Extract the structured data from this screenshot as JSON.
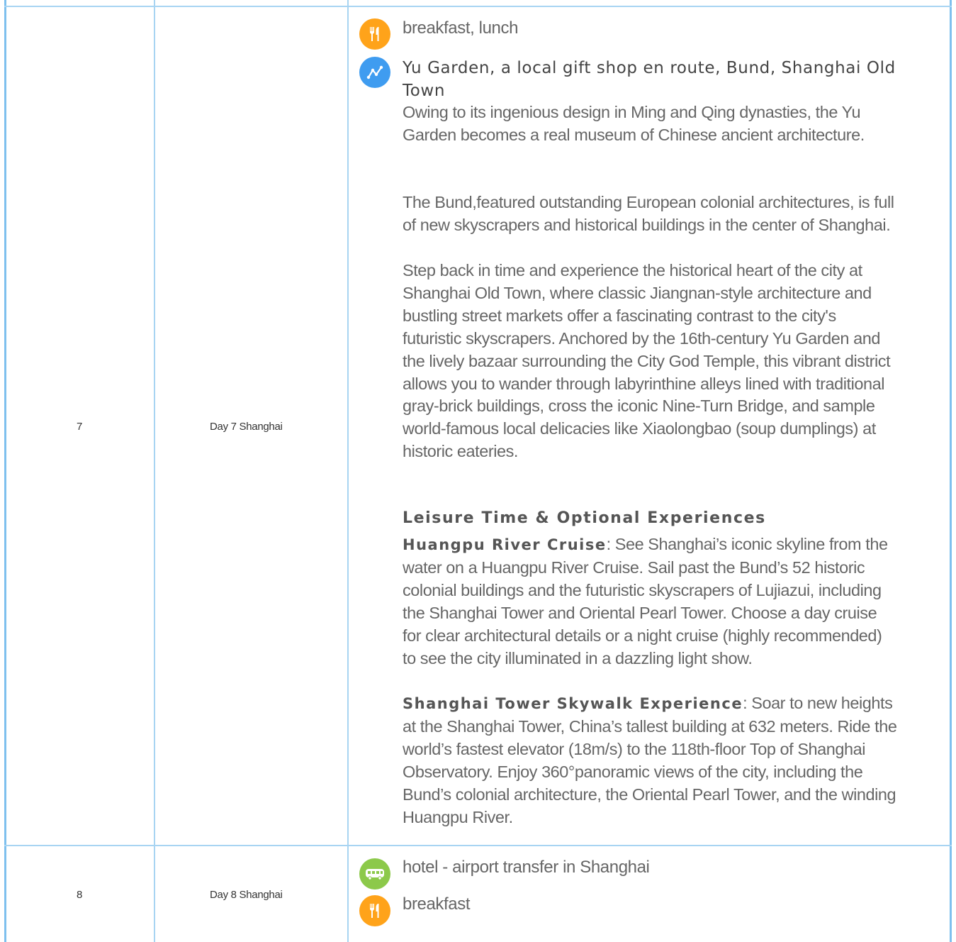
{
  "rows": [
    {
      "day_number": "7",
      "day_label": "Day 7 Shanghai",
      "meals": "breakfast, lunch",
      "route_title": "Yu Garden, a local gift shop en route, Bund, Shanghai Old Town",
      "paragraphs": [
        "Owing to its ingenious design in Ming and Qing dynasties, the Yu Garden becomes a real museum of Chinese ancient architecture.",
        "The Bund,featured outstanding European colonial architectures, is full of new skyscrapers and historical buildings in the center of Shanghai.",
        "Step back in time and experience the historical heart of the city at Shanghai Old Town, where classic Jiangnan-style architecture and bustling street markets offer a fascinating contrast to the city's futuristic skyscrapers. Anchored by the 16th-century Yu Garden and the lively bazaar surrounding the City God Temple, this vibrant district allows you to wander through labyrinthine alleys lined with traditional gray-brick buildings, cross the iconic Nine-Turn Bridge, and sample world-famous local delicacies like Xiaolongbao (soup dumplings) at historic eateries."
      ],
      "optional_heading": "Leisure Time & Optional Experiences",
      "optional": [
        {
          "name": "Huangpu River Cruise",
          "text": ": See Shanghai’s iconic skyline from the water on a Huangpu River Cruise. Sail past the Bund’s 52 historic colonial buildings and the futuristic skyscrapers of Lujiazui, including the Shanghai Tower and Oriental Pearl Tower. Choose a day cruise for clear architectural details or a night cruise (highly recommended) to see the city illuminated in a dazzling light show."
        },
        {
          "name": "Shanghai Tower Skywalk Experience",
          "text": ": Soar to new heights at the Shanghai Tower, China’s tallest building at 632 meters. Ride the world’s fastest elevator (18m/s) to the 118th-floor Top of Shanghai Observatory. Enjoy 360°panoramic views of the city, including the Bund’s colonial architecture, the Oriental Pearl Tower, and the winding Huangpu River."
        }
      ]
    },
    {
      "day_number": "8",
      "day_label": "Day 8 Shanghai",
      "transfer": "hotel - airport transfer in Shanghai",
      "meals": "breakfast"
    }
  ],
  "icons": {
    "meal": "fork-knife-icon",
    "route": "route-icon",
    "transfer": "bus-icon"
  },
  "colors": {
    "border": "#a8d4f2",
    "meal_icon": "#ffa31a",
    "route_icon": "#3f9cf0",
    "transfer_icon": "#8cc94a"
  }
}
